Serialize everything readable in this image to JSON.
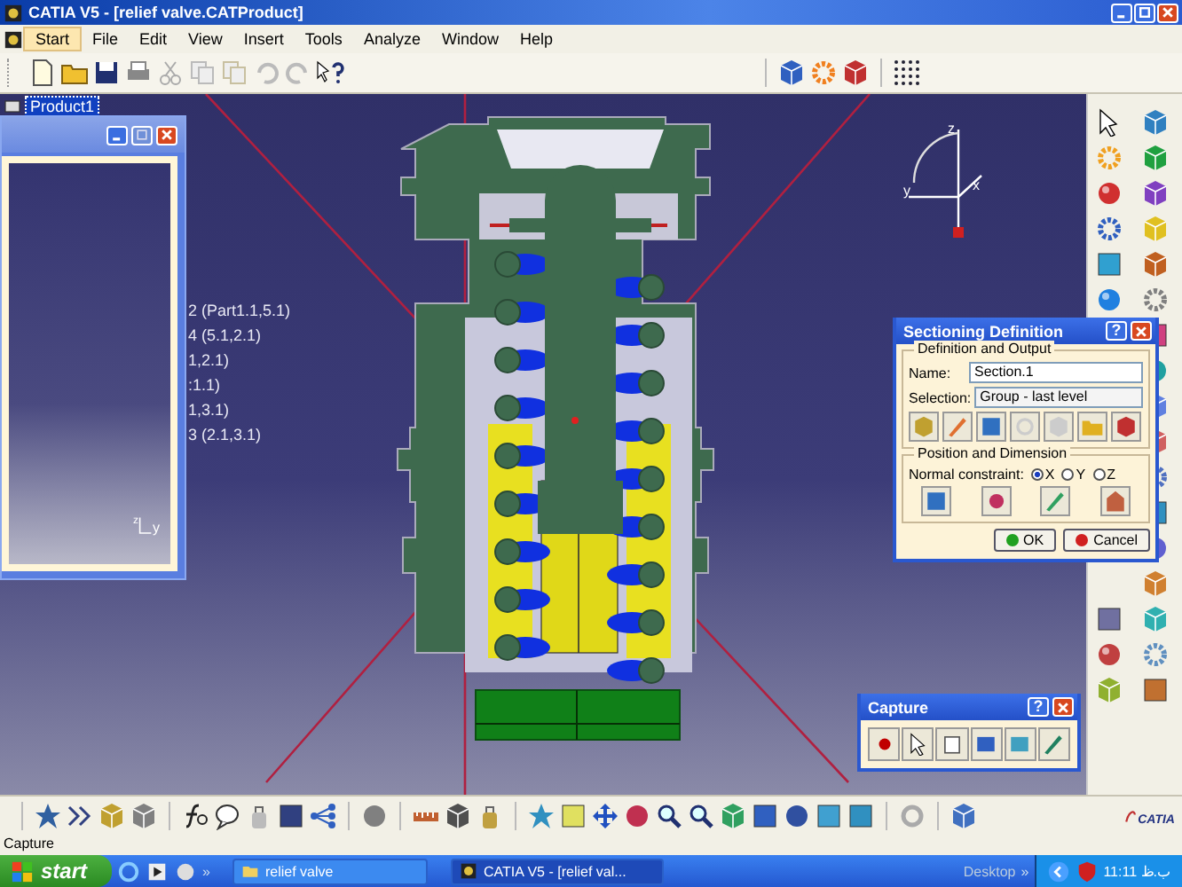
{
  "window": {
    "title": "CATIA V5 - [relief valve.CATProduct]"
  },
  "menu": [
    {
      "label": "Start",
      "selected": true
    },
    {
      "label": "File",
      "selected": false
    },
    {
      "label": "Edit",
      "selected": false
    },
    {
      "label": "View",
      "selected": false
    },
    {
      "label": "Insert",
      "selected": false
    },
    {
      "label": "Tools",
      "selected": false
    },
    {
      "label": "Analyze",
      "selected": false
    },
    {
      "label": "Window",
      "selected": false
    },
    {
      "label": "Help",
      "selected": false
    }
  ],
  "tree": {
    "root": "Product1",
    "selected": true
  },
  "sub_window": {
    "axis_labels": [
      "z",
      "y"
    ]
  },
  "constraints": [
    "2 (Part1.1,5.1)",
    "4 (5.1,2.1)",
    "1,2.1)",
    ":1.1)",
    "1,3.1)",
    "3 (2.1,3.1)"
  ],
  "compass_labels": [
    "z",
    "y",
    "x"
  ],
  "sectioning_dialog": {
    "title": "Sectioning Definition",
    "help": "?",
    "group1": "Definition and Output",
    "name_label": "Name:",
    "name_value": "Section.1",
    "selection_label": "Selection:",
    "selection_value": "Group - last level",
    "group2": "Position and Dimension",
    "constraint_label": "Normal constraint:",
    "axes": [
      {
        "label": "X",
        "selected": true
      },
      {
        "label": "Y",
        "selected": false
      },
      {
        "label": "Z",
        "selected": false
      }
    ],
    "ok": "OK",
    "cancel": "Cancel"
  },
  "capture_dialog": {
    "title": "Capture",
    "help": "?"
  },
  "logo_text": "CATIA",
  "status_bar": "Capture",
  "taskbar": {
    "start": "start",
    "chevron": "»",
    "tasks": [
      {
        "label": "relief valve",
        "selected": false
      },
      {
        "label": "CATIA V5 - [relief val...",
        "selected": true
      }
    ],
    "desktop": "Desktop",
    "tray_chevron": "»",
    "clock": "11:11 ب.ظ"
  }
}
